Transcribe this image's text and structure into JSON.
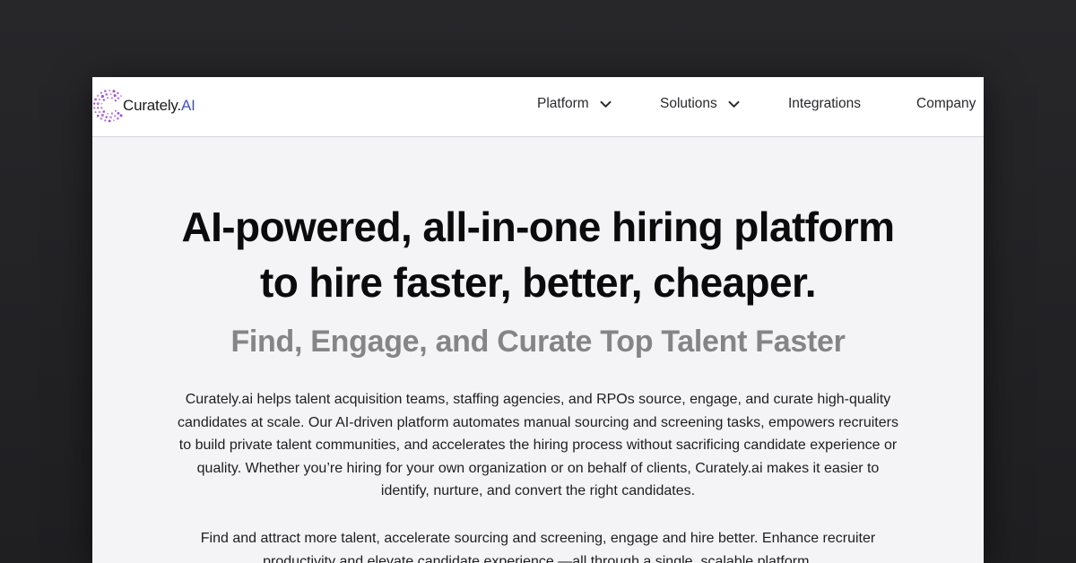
{
  "brand": {
    "name": "Curately.",
    "name_suffix": "AI",
    "accent_color": "#3f55c9",
    "logo_dot_color": "#9b4fd1"
  },
  "nav": {
    "items": [
      {
        "label": "Platform",
        "has_dropdown": true
      },
      {
        "label": "Solutions",
        "has_dropdown": true
      },
      {
        "label": "Integrations",
        "has_dropdown": false
      },
      {
        "label": "Company",
        "has_dropdown": false
      }
    ]
  },
  "hero": {
    "title_line1": "AI-powered, all-in-one hiring platform",
    "title_line2": "to hire faster, better, cheaper.",
    "subtitle": "Find, Engage, and Curate Top Talent Faster",
    "paragraph1": "Curately.ai helps talent acquisition teams, staffing agencies, and RPOs source, engage, and curate high-quality candidates at scale. Our AI-driven platform automates manual sourcing and screening tasks, empowers recruiters to build private talent communities, and accelerates the hiring process without sacrificing candidate experience or quality. Whether you’re hiring for your own organization or on behalf of clients, Curately.ai makes it easier to identify, nurture, and convert the right candidates.",
    "paragraph2": "Find and attract more talent, accelerate sourcing and screening, engage and hire better. Enhance recruiter productivity and elevate candidate experience —all through a single, scalable platform."
  }
}
